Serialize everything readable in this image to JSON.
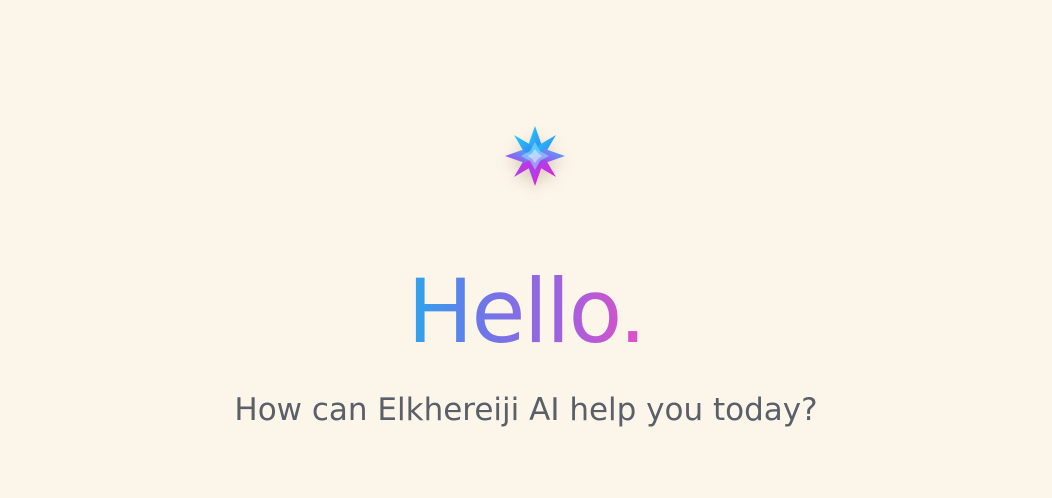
{
  "greeting": {
    "title": "Hello.",
    "subtitle": "How can Elkhereiji AI help you today?"
  },
  "logo": {
    "icon": "star-flower-icon",
    "colors": [
      "#16c7f2",
      "#4f7df5",
      "#a24bf0",
      "#f51dd8"
    ]
  },
  "colors": {
    "background": "#fcf5ea",
    "subtitle": "#5b5f68",
    "gradient_start": "#2aa7ee",
    "gradient_end": "#e24fc6"
  }
}
